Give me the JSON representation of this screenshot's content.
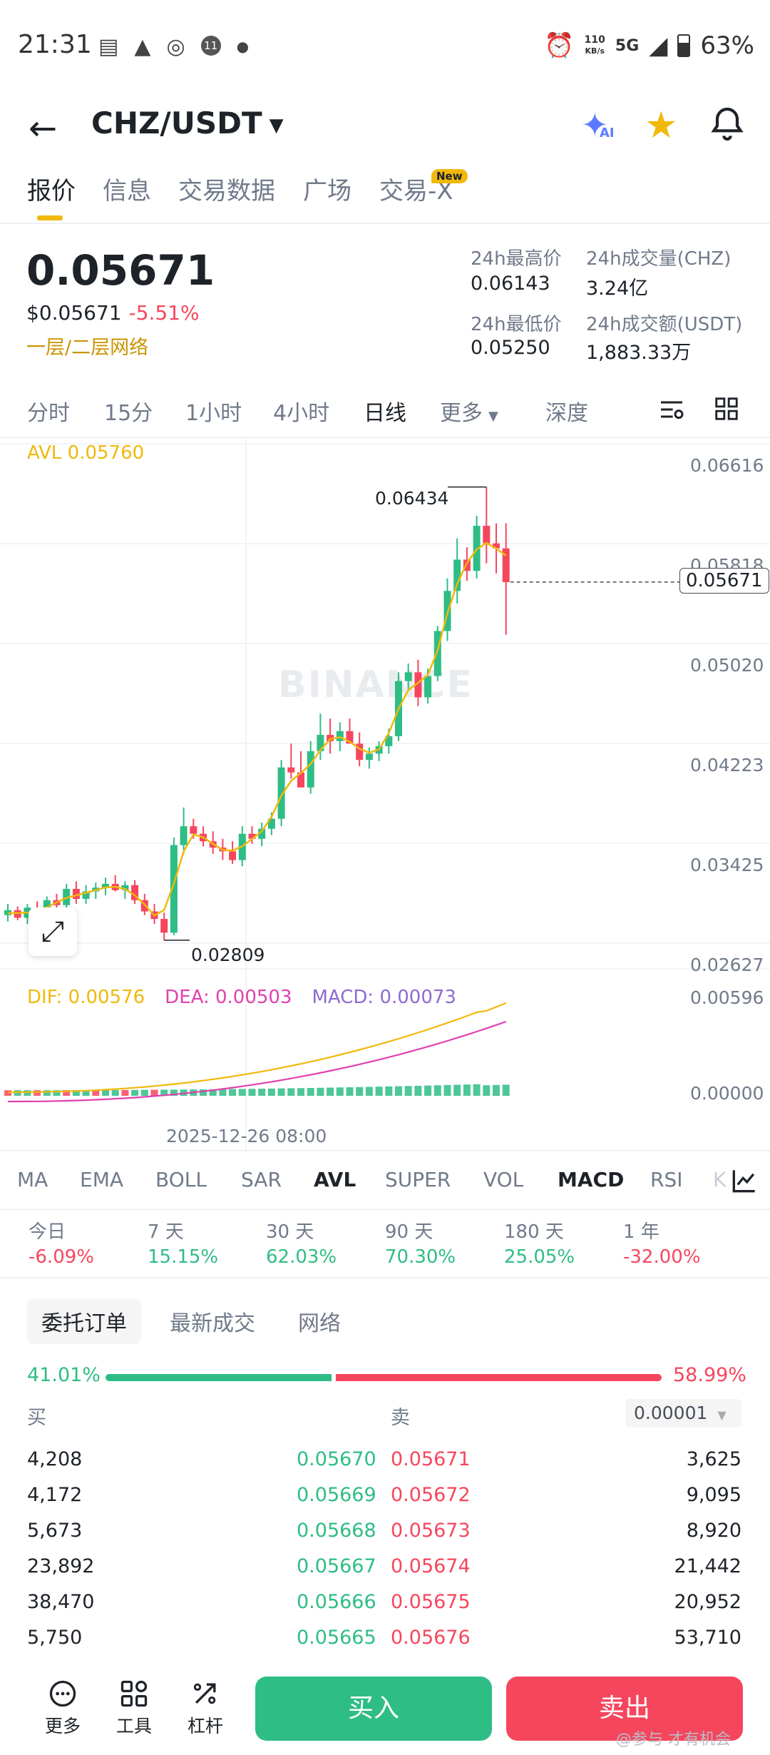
{
  "status_bar": {
    "time": "21:31",
    "left_icons": [
      "news-icon",
      "warning-icon",
      "wechat-icon",
      "notification-count-icon",
      "dot-icon"
    ],
    "notification_count": "11",
    "net_speed_value": "110",
    "net_speed_unit": "KB/s",
    "network": "5G",
    "battery": "63%"
  },
  "header": {
    "pair": "CHZ/USDT",
    "ai_label": "AI"
  },
  "tabs": [
    "报价",
    "信息",
    "交易数据",
    "广场",
    "交易-X"
  ],
  "new_badge": "New",
  "market": {
    "price": "0.05671",
    "usd_price": "$0.05671",
    "change": "-5.51%",
    "layer_tag": "一层/二层网络",
    "high_label": "24h最高价",
    "high_value": "0.06143",
    "low_label": "24h最低价",
    "low_value": "0.05250",
    "vol_label": "24h成交量(CHZ)",
    "vol_value": "3.24亿",
    "turnover_label": "24h成交额(USDT)",
    "turnover_value": "1,883.33万"
  },
  "intervals": [
    "分时",
    "15分",
    "1小时",
    "4小时",
    "日线",
    "更多",
    "深度"
  ],
  "active_interval": "日线",
  "chart_data": {
    "type": "candlestick",
    "title": "",
    "interval": "日线",
    "avl_label": "AVL 0.05760",
    "y_ticks": [
      "0.06616",
      "0.05818",
      "0.05020",
      "0.04223",
      "0.03425",
      "0.02627"
    ],
    "ylim": [
      0.02627,
      0.06616
    ],
    "current_price": "0.05671",
    "max_label": "0.06434",
    "min_label": "0.02809",
    "watermark": "BINANCE",
    "x_label": "2025-12-26 08:00",
    "grid": true,
    "candles": [
      {
        "o": 0.0301,
        "h": 0.031,
        "l": 0.0296,
        "c": 0.0305
      },
      {
        "o": 0.0305,
        "h": 0.0308,
        "l": 0.0297,
        "c": 0.0299
      },
      {
        "o": 0.0299,
        "h": 0.031,
        "l": 0.0294,
        "c": 0.0307
      },
      {
        "o": 0.0307,
        "h": 0.0312,
        "l": 0.03,
        "c": 0.0301
      },
      {
        "o": 0.0301,
        "h": 0.0316,
        "l": 0.0298,
        "c": 0.0313
      },
      {
        "o": 0.0313,
        "h": 0.0318,
        "l": 0.0305,
        "c": 0.0309
      },
      {
        "o": 0.0309,
        "h": 0.0326,
        "l": 0.0306,
        "c": 0.0322
      },
      {
        "o": 0.0322,
        "h": 0.0328,
        "l": 0.031,
        "c": 0.0314
      },
      {
        "o": 0.0314,
        "h": 0.0325,
        "l": 0.031,
        "c": 0.032
      },
      {
        "o": 0.032,
        "h": 0.0327,
        "l": 0.0314,
        "c": 0.0323
      },
      {
        "o": 0.0323,
        "h": 0.0331,
        "l": 0.0317,
        "c": 0.0326
      },
      {
        "o": 0.0326,
        "h": 0.0333,
        "l": 0.032,
        "c": 0.0321
      },
      {
        "o": 0.0321,
        "h": 0.0328,
        "l": 0.0314,
        "c": 0.0325
      },
      {
        "o": 0.0325,
        "h": 0.0329,
        "l": 0.031,
        "c": 0.0313
      },
      {
        "o": 0.0313,
        "h": 0.0318,
        "l": 0.0301,
        "c": 0.0304
      },
      {
        "o": 0.0304,
        "h": 0.031,
        "l": 0.0294,
        "c": 0.0298
      },
      {
        "o": 0.0298,
        "h": 0.0303,
        "l": 0.0281,
        "c": 0.0287
      },
      {
        "o": 0.0287,
        "h": 0.0363,
        "l": 0.0285,
        "c": 0.0357
      },
      {
        "o": 0.0357,
        "h": 0.0387,
        "l": 0.035,
        "c": 0.0372
      },
      {
        "o": 0.0372,
        "h": 0.0378,
        "l": 0.0362,
        "c": 0.0366
      },
      {
        "o": 0.0366,
        "h": 0.0372,
        "l": 0.0356,
        "c": 0.036
      },
      {
        "o": 0.036,
        "h": 0.0368,
        "l": 0.035,
        "c": 0.0355
      },
      {
        "o": 0.0355,
        "h": 0.0362,
        "l": 0.0345,
        "c": 0.0352
      },
      {
        "o": 0.0352,
        "h": 0.036,
        "l": 0.0342,
        "c": 0.0345
      },
      {
        "o": 0.0345,
        "h": 0.0372,
        "l": 0.034,
        "c": 0.0366
      },
      {
        "o": 0.0366,
        "h": 0.0372,
        "l": 0.0358,
        "c": 0.0362
      },
      {
        "o": 0.0362,
        "h": 0.0375,
        "l": 0.0356,
        "c": 0.037
      },
      {
        "o": 0.037,
        "h": 0.0383,
        "l": 0.0365,
        "c": 0.0378
      },
      {
        "o": 0.0378,
        "h": 0.0425,
        "l": 0.0372,
        "c": 0.0419
      },
      {
        "o": 0.0419,
        "h": 0.0438,
        "l": 0.041,
        "c": 0.0415
      },
      {
        "o": 0.0415,
        "h": 0.0432,
        "l": 0.0405,
        "c": 0.0403
      },
      {
        "o": 0.0403,
        "h": 0.044,
        "l": 0.0398,
        "c": 0.0432
      },
      {
        "o": 0.0432,
        "h": 0.0462,
        "l": 0.0425,
        "c": 0.0445
      },
      {
        "o": 0.0445,
        "h": 0.0458,
        "l": 0.043,
        "c": 0.044
      },
      {
        "o": 0.044,
        "h": 0.0455,
        "l": 0.0432,
        "c": 0.0448
      },
      {
        "o": 0.0448,
        "h": 0.0458,
        "l": 0.044,
        "c": 0.0438
      },
      {
        "o": 0.0438,
        "h": 0.0447,
        "l": 0.042,
        "c": 0.0425
      },
      {
        "o": 0.0425,
        "h": 0.0435,
        "l": 0.0418,
        "c": 0.043
      },
      {
        "o": 0.043,
        "h": 0.044,
        "l": 0.0424,
        "c": 0.0436
      },
      {
        "o": 0.0436,
        "h": 0.045,
        "l": 0.043,
        "c": 0.0444
      },
      {
        "o": 0.0444,
        "h": 0.0495,
        "l": 0.044,
        "c": 0.0488
      },
      {
        "o": 0.0488,
        "h": 0.0502,
        "l": 0.048,
        "c": 0.0495
      },
      {
        "o": 0.0495,
        "h": 0.0505,
        "l": 0.0468,
        "c": 0.0475
      },
      {
        "o": 0.0475,
        "h": 0.0498,
        "l": 0.047,
        "c": 0.0492
      },
      {
        "o": 0.0492,
        "h": 0.0532,
        "l": 0.0488,
        "c": 0.0528
      },
      {
        "o": 0.0528,
        "h": 0.057,
        "l": 0.052,
        "c": 0.056
      },
      {
        "o": 0.056,
        "h": 0.0602,
        "l": 0.055,
        "c": 0.0585
      },
      {
        "o": 0.0585,
        "h": 0.0595,
        "l": 0.0568,
        "c": 0.0576
      },
      {
        "o": 0.0576,
        "h": 0.062,
        "l": 0.057,
        "c": 0.0612
      },
      {
        "o": 0.0612,
        "h": 0.0643,
        "l": 0.0582,
        "c": 0.0598
      },
      {
        "o": 0.0598,
        "h": 0.0614,
        "l": 0.0574,
        "c": 0.0594
      },
      {
        "o": 0.0594,
        "h": 0.0614,
        "l": 0.0525,
        "c": 0.0567
      }
    ],
    "macd": {
      "dif_label": "DIF: 0.00576",
      "dea_label": "DEA: 0.00503",
      "macd_label": "MACD: 0.00073",
      "y_ticks": [
        "0.00596",
        "0.00000"
      ],
      "ylim": [
        0,
        0.00596
      ]
    },
    "colors": {
      "up": "#2ebd85",
      "down": "#f6465d",
      "avl": "#f0b90b",
      "dif": "#f0b90b",
      "dea": "#e040b0",
      "macd": "#8e6bd0"
    }
  },
  "indicators": [
    "MA",
    "EMA",
    "BOLL",
    "SAR",
    "AVL",
    "SUPER",
    "VOL",
    "MACD",
    "RSI",
    "K"
  ],
  "active_indicators": [
    "AVL",
    "MACD"
  ],
  "performance": [
    {
      "label": "今日",
      "value": "-6.09%",
      "dir": "down"
    },
    {
      "label": "7 天",
      "value": "15.15%",
      "dir": "up"
    },
    {
      "label": "30 天",
      "value": "62.03%",
      "dir": "up"
    },
    {
      "label": "90 天",
      "value": "70.30%",
      "dir": "up"
    },
    {
      "label": "180 天",
      "value": "25.05%",
      "dir": "up"
    },
    {
      "label": "1 年",
      "value": "-32.00%",
      "dir": "down"
    }
  ],
  "orderbook": {
    "tabs": [
      "委托订单",
      "最新成交",
      "网络"
    ],
    "buy_ratio": "41.01%",
    "sell_ratio": "58.99%",
    "buy_fraction": 0.4101,
    "buy_label": "买",
    "sell_label": "卖",
    "tick_size": "0.00001",
    "rows": [
      {
        "bid_qty": "4,208",
        "bid": "0.05670",
        "ask": "0.05671",
        "ask_qty": "3,625"
      },
      {
        "bid_qty": "4,172",
        "bid": "0.05669",
        "ask": "0.05672",
        "ask_qty": "9,095"
      },
      {
        "bid_qty": "5,673",
        "bid": "0.05668",
        "ask": "0.05673",
        "ask_qty": "8,920"
      },
      {
        "bid_qty": "23,892",
        "bid": "0.05667",
        "ask": "0.05674",
        "ask_qty": "21,442"
      },
      {
        "bid_qty": "38,470",
        "bid": "0.05666",
        "ask": "0.05675",
        "ask_qty": "20,952"
      },
      {
        "bid_qty": "5,750",
        "bid": "0.05665",
        "ask": "0.05676",
        "ask_qty": "53,710"
      }
    ]
  },
  "bottom_bar": {
    "more_label": "更多",
    "tools_label": "工具",
    "leverage_label": "杠杆",
    "buy_button": "买入",
    "sell_button": "卖出"
  },
  "footer_watermark": "@参与 才有机会"
}
